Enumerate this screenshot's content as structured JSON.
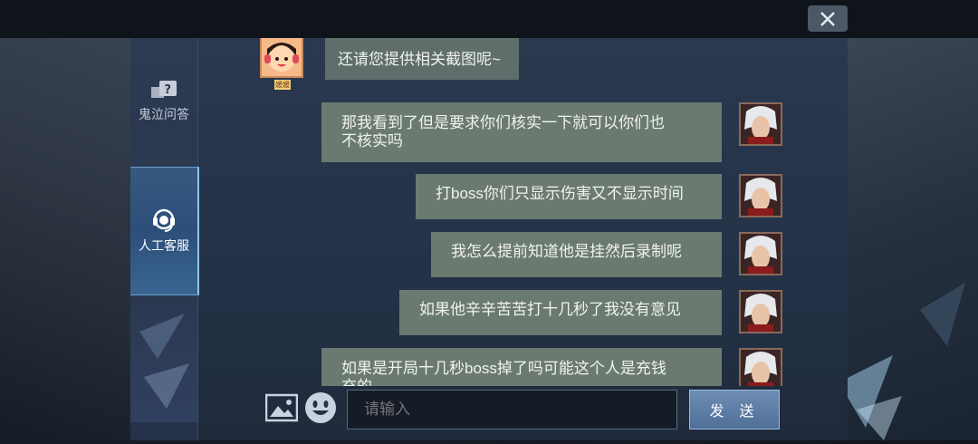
{
  "window": {
    "close_icon": "close-icon"
  },
  "sidebar": {
    "items": [
      {
        "label": "鬼泣问答",
        "icon": "question-chat-icon",
        "active": false
      },
      {
        "label": "人工客服",
        "icon": "headset-icon",
        "active": true
      }
    ]
  },
  "chat": {
    "messages": [
      {
        "sender": "agent",
        "text": "还请您提供相关截图呢~",
        "avatar_caption": "媛媛"
      },
      {
        "sender": "user",
        "lines": [
          "那我看到了但是要求你们核实一下就可以你们也",
          "不核实吗"
        ]
      },
      {
        "sender": "user",
        "text": "打boss你们只显示伤害又不显示时间"
      },
      {
        "sender": "user",
        "text": "我怎么提前知道他是挂然后录制呢"
      },
      {
        "sender": "user",
        "text": "如果他辛辛苦苦打十几秒了我没有意见"
      },
      {
        "sender": "user",
        "lines": [
          "如果是开局十几秒boss掉了吗可能这个人是充钱",
          "充的"
        ]
      }
    ]
  },
  "input": {
    "placeholder": "请输入",
    "send_label": "发 送",
    "image_icon": "image-icon",
    "emoji_icon": "emoji-icon"
  }
}
